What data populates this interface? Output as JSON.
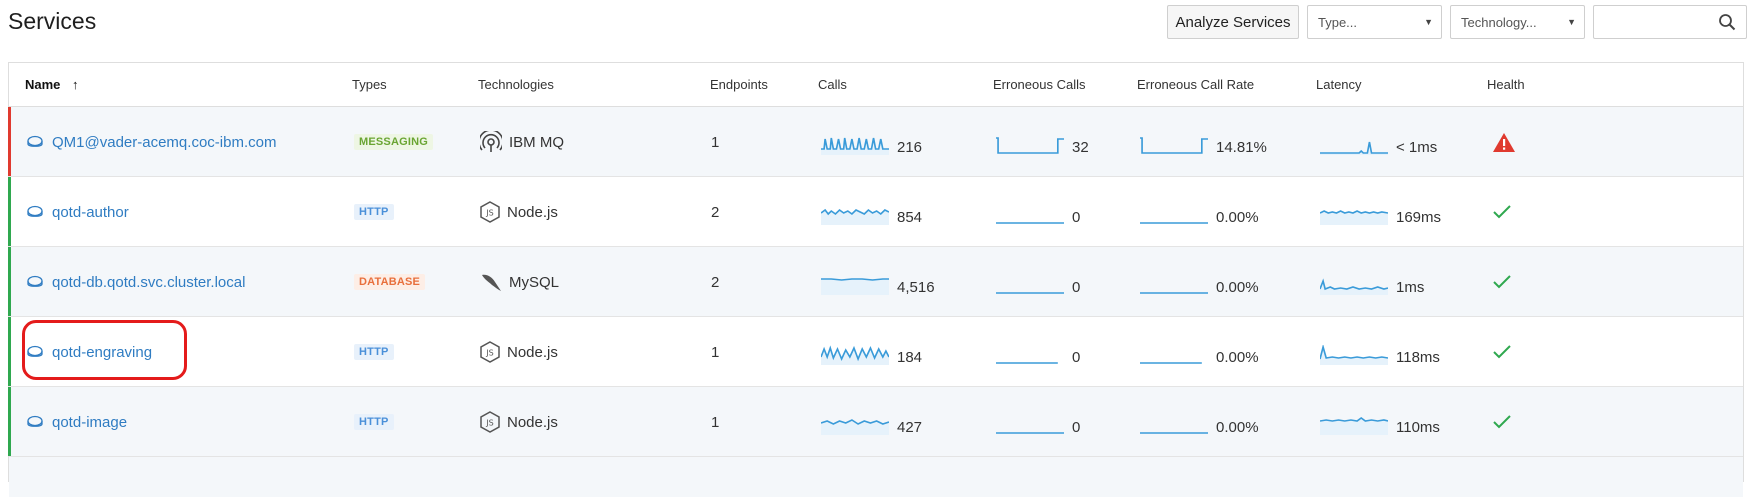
{
  "page": {
    "title": "Services"
  },
  "toolbar": {
    "analyze_label": "Analyze Services",
    "type_placeholder": "Type...",
    "technology_placeholder": "Technology...",
    "search_value": ""
  },
  "columns": {
    "name": "Name",
    "types": "Types",
    "technologies": "Technologies",
    "endpoints": "Endpoints",
    "calls": "Calls",
    "erroneous_calls": "Erroneous Calls",
    "erroneous_call_rate": "Erroneous Call Rate",
    "latency": "Latency",
    "health": "Health"
  },
  "sort": {
    "column": "name",
    "direction": "asc"
  },
  "colors": {
    "link": "#2f7cc2",
    "spark": "#3a9bd9",
    "ok": "#2fa84f",
    "alert": "#e03a2f",
    "highlight": "#e41b1b"
  },
  "services": [
    {
      "name": "QM1@vader-acemq.coc-ibm.com",
      "type": "MESSAGING",
      "technology": "IBM MQ",
      "tech_icon": "ibmmq-icon",
      "endpoints": "1",
      "calls": "216",
      "erroneous_calls": "32",
      "error_rate": "14.81%",
      "latency": "< 1ms",
      "health": "warning",
      "status": "alert"
    },
    {
      "name": "qotd-author",
      "type": "HTTP",
      "technology": "Node.js",
      "tech_icon": "nodejs-icon",
      "endpoints": "2",
      "calls": "854",
      "erroneous_calls": "0",
      "error_rate": "0.00%",
      "latency": "169ms",
      "health": "ok",
      "status": "ok"
    },
    {
      "name": "qotd-db.qotd.svc.cluster.local",
      "type": "DATABASE",
      "technology": "MySQL",
      "tech_icon": "mysql-icon",
      "endpoints": "2",
      "calls": "4,516",
      "erroneous_calls": "0",
      "error_rate": "0.00%",
      "latency": "1ms",
      "health": "ok",
      "status": "ok"
    },
    {
      "name": "qotd-engraving",
      "type": "HTTP",
      "technology": "Node.js",
      "tech_icon": "nodejs-icon",
      "endpoints": "1",
      "calls": "184",
      "erroneous_calls": "0",
      "error_rate": "0.00%",
      "latency": "118ms",
      "health": "ok",
      "status": "ok"
    },
    {
      "name": "qotd-image",
      "type": "HTTP",
      "technology": "Node.js",
      "tech_icon": "nodejs-icon",
      "endpoints": "1",
      "calls": "427",
      "erroneous_calls": "0",
      "error_rate": "0.00%",
      "latency": "110ms",
      "health": "ok",
      "status": "ok"
    }
  ]
}
